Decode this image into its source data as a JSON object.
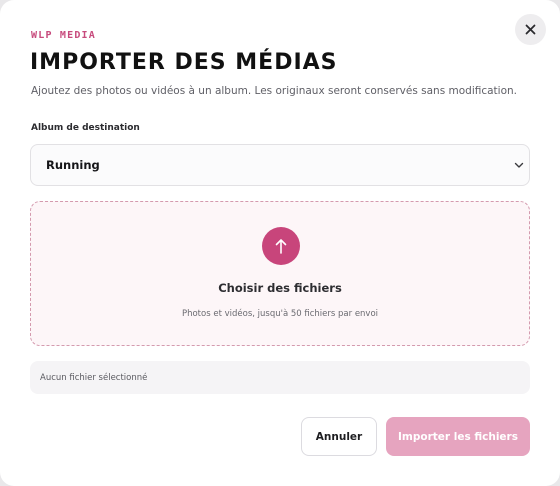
{
  "modal": {
    "eyebrow": "WLP MEDIA",
    "title": "IMPORTER DES MÉDIAS",
    "subtitle": "Ajoutez des photos ou vidéos à un album. Les originaux seront conservés sans modification.",
    "close_icon": "close-icon"
  },
  "album": {
    "label": "Album de destination",
    "selected": "Running",
    "chevron_icon": "chevron-down-icon"
  },
  "dropzone": {
    "icon": "upload-arrow-icon",
    "title": "Choisir des fichiers",
    "hint": "Photos et vidéos, jusqu'à 50 fichiers par envoi"
  },
  "file_status": "Aucun fichier sélectionné",
  "actions": {
    "cancel_label": "Annuler",
    "import_label": "Importer les fichiers"
  },
  "colors": {
    "accent": "#c8457b",
    "accent_disabled": "#e6a4bf",
    "dropzone_bg": "#fdf6f8",
    "dropzone_border": "#d49aae"
  }
}
